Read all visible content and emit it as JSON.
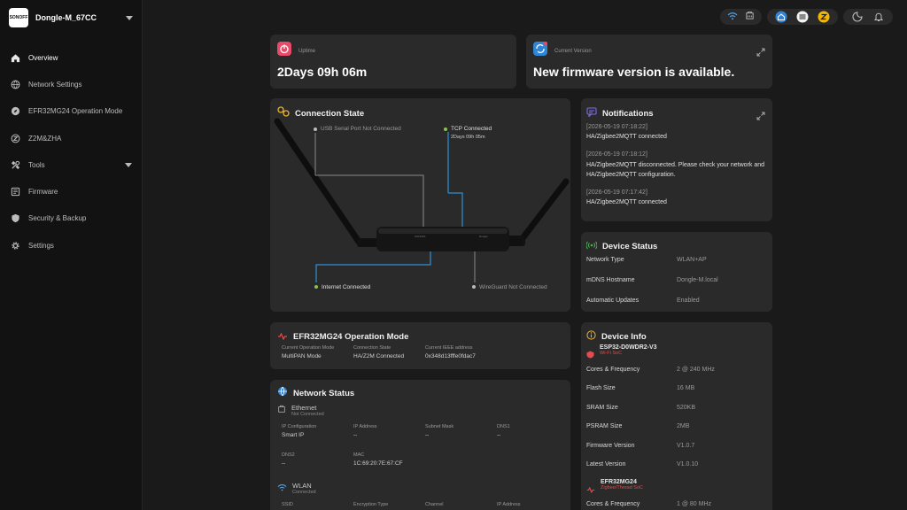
{
  "sidebar": {
    "brand_logo": "SONOFF",
    "title": "Dongle-M_67CC",
    "items": [
      {
        "label": "Overview",
        "icon": "home-icon"
      },
      {
        "label": "Network Settings",
        "icon": "globe-icon"
      },
      {
        "label": "EFR32MG24 Operation Mode",
        "icon": "compass-icon"
      },
      {
        "label": "Z2M&ZHA",
        "icon": "z2m-icon"
      },
      {
        "label": "Tools",
        "icon": "tools-icon"
      },
      {
        "label": "Firmware",
        "icon": "firmware-icon"
      },
      {
        "label": "Security & Backup",
        "icon": "shield-icon"
      },
      {
        "label": "Settings",
        "icon": "gear-icon"
      }
    ]
  },
  "uptime": {
    "label": "Uptime",
    "value": "2Days 09h 06m"
  },
  "version": {
    "label": "Current Version",
    "value": "New firmware version is available."
  },
  "connection": {
    "title": "Connection State",
    "usb": "USB Serial Port Not Connected",
    "tcp": "TCP Connected",
    "tcp_time": "2Days 09h 05m",
    "internet": "Internet Connected",
    "wireguard": "WireGuard Not Connected",
    "device_label_left": "SONOFF",
    "device_label_right": "Dongle"
  },
  "notifications": {
    "title": "Notifications",
    "entries": [
      {
        "ts": "[2026-05-19 07:18:22]",
        "msg": "HA/Zigbee2MQTT connected"
      },
      {
        "ts": "[2026-05-19 07:18:12]",
        "msg": "HA/Zigbee2MQTT disconnected. Please check your network and HA/Zigbee2MQTT configuration."
      },
      {
        "ts": "[2026-05-19 07:17:42]",
        "msg": "HA/Zigbee2MQTT connected"
      }
    ]
  },
  "device_status": {
    "title": "Device Status",
    "rows": [
      {
        "k": "Network Type",
        "v": "WLAN+AP"
      },
      {
        "k": "mDNS Hostname",
        "v": "Dongle-M.local"
      },
      {
        "k": "Automatic Updates",
        "v": "Enabled"
      }
    ]
  },
  "efr": {
    "title": "EFR32MG24 Operation Mode",
    "cols": [
      {
        "label": "Current Operation Mode",
        "value": "MultiPAN Mode"
      },
      {
        "label": "Connection State",
        "value": "HA/Z2M Connected"
      },
      {
        "label": "Current IEEE address",
        "value": "0x348d13fffe0fdac7"
      }
    ]
  },
  "network_status": {
    "title": "Network Status",
    "ethernet": {
      "name": "Ethernet",
      "state": "Not Connected"
    },
    "eth_row1": [
      {
        "label": "IP Configuration",
        "value": "Smart IP"
      },
      {
        "label": "IP Address",
        "value": "--"
      },
      {
        "label": "Subnet Mask",
        "value": "--"
      },
      {
        "label": "DNS1",
        "value": "--"
      }
    ],
    "eth_row2": [
      {
        "label": "DNS2",
        "value": "--"
      },
      {
        "label": "MAC",
        "value": "1C:69:20:7E:67:CF"
      }
    ],
    "wlan": {
      "name": "WLAN",
      "state": "Connected"
    },
    "wlan_row": [
      {
        "label": "SSID"
      },
      {
        "label": "Encryption Type"
      },
      {
        "label": "Channel"
      },
      {
        "label": "IP Address"
      }
    ]
  },
  "device_info": {
    "title": "Device Info",
    "chip1": {
      "name": "ESP32-D0WDR2-V3",
      "sub": "Wi-Fi SoC"
    },
    "rows": [
      {
        "k": "Cores & Frequency",
        "v": "2 @ 240 MHz"
      },
      {
        "k": "Flash Size",
        "v": "16 MB"
      },
      {
        "k": "SRAM Size",
        "v": "520KB"
      },
      {
        "k": "PSRAM Size",
        "v": "2MB"
      },
      {
        "k": "Firmware Version",
        "v": "V1.0.7"
      },
      {
        "k": "Latest Version",
        "v": "V1.0.10"
      }
    ],
    "chip2": {
      "name": "EFR32MG24",
      "sub": "Zigbee/Thread SoC"
    },
    "rows2": [
      {
        "k": "Cores & Frequency",
        "v": "1 @ 80 MHz"
      }
    ]
  },
  "colors": {
    "accent_pink": "#e84a6a",
    "accent_blue": "#2f86d6",
    "line_blue": "#2f8fd8",
    "dot_green": "#8bc34a"
  }
}
